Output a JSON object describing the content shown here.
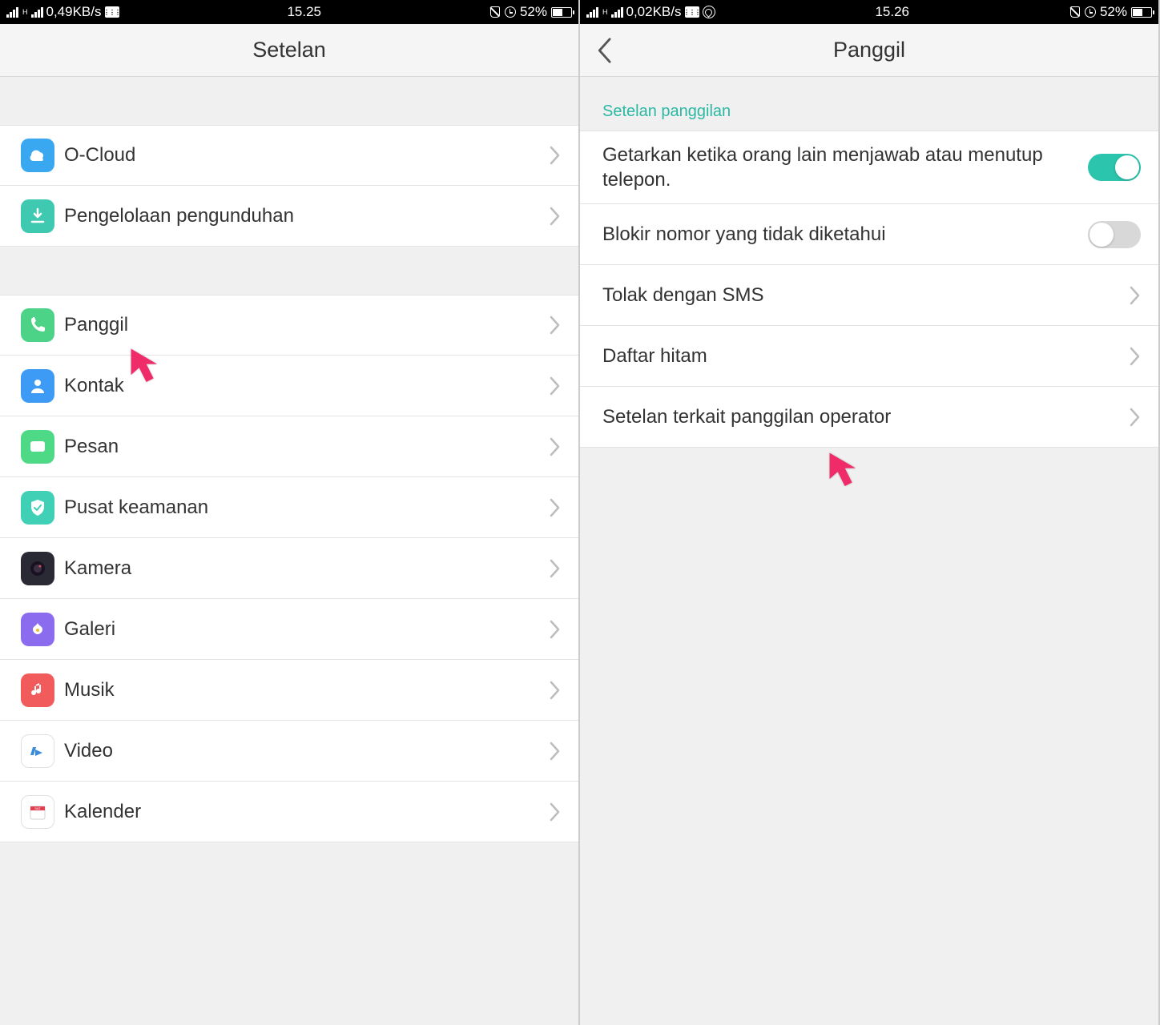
{
  "left": {
    "status": {
      "speed": "0,49KB/s",
      "time": "15.25",
      "battery_pct": "52%"
    },
    "header": {
      "title": "Setelan"
    },
    "group1": [
      {
        "label": "O-Cloud",
        "icon": "cloud",
        "bg": "bg-blue"
      },
      {
        "label": "Pengelolaan pengunduhan",
        "icon": "download",
        "bg": "bg-teal"
      }
    ],
    "group2": [
      {
        "label": "Panggil",
        "icon": "phone",
        "bg": "bg-green"
      },
      {
        "label": "Kontak",
        "icon": "contact",
        "bg": "bg-blue2"
      },
      {
        "label": "Pesan",
        "icon": "message",
        "bg": "bg-green2"
      },
      {
        "label": "Pusat keamanan",
        "icon": "shield",
        "bg": "bg-teal2"
      },
      {
        "label": "Kamera",
        "icon": "camera",
        "bg": "bg-dark"
      },
      {
        "label": "Galeri",
        "icon": "gallery",
        "bg": "bg-purple"
      },
      {
        "label": "Musik",
        "icon": "music",
        "bg": "bg-red"
      },
      {
        "label": "Video",
        "icon": "video",
        "bg": "bg-white"
      },
      {
        "label": "Kalender",
        "icon": "calendar",
        "bg": "bg-white"
      }
    ]
  },
  "right": {
    "status": {
      "speed": "0,02KB/s",
      "time": "15.26",
      "battery_pct": "52%"
    },
    "header": {
      "title": "Panggil"
    },
    "section_header": "Setelan panggilan",
    "items": [
      {
        "label": "Getarkan ketika orang lain menjawab atau menutup telepon.",
        "type": "toggle",
        "value": true
      },
      {
        "label": "Blokir nomor yang tidak diketahui",
        "type": "toggle",
        "value": false
      },
      {
        "label": "Tolak dengan SMS",
        "type": "nav"
      },
      {
        "label": "Daftar hitam",
        "type": "nav"
      },
      {
        "label": "Setelan terkait panggilan operator",
        "type": "nav"
      }
    ]
  },
  "colors": {
    "accent": "#2bc4ad",
    "pointer": "#ef2b6a"
  }
}
